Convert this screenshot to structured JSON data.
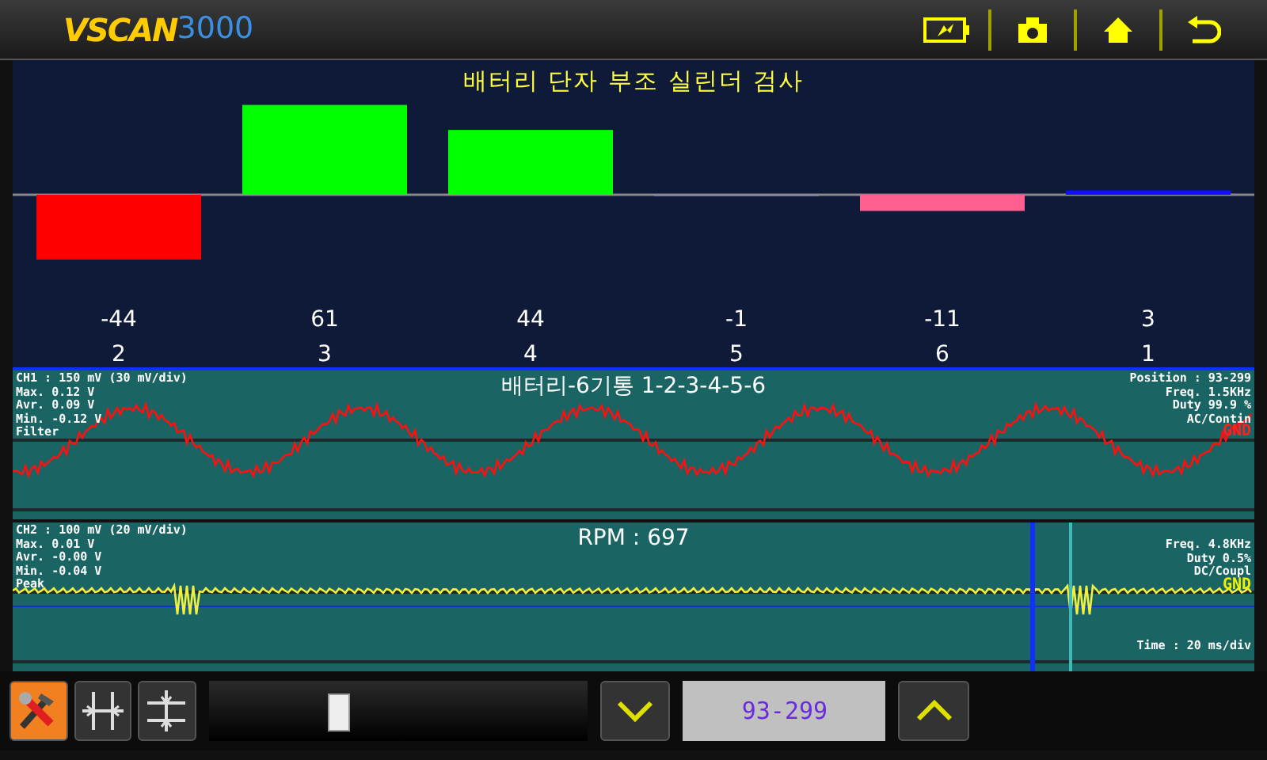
{
  "header": {
    "logo_text": "VSCAN",
    "logo_number": "3000"
  },
  "balance_panel": {
    "title": "배터리 단자 부조 실린더 검사",
    "chart_data": {
      "type": "bar",
      "categories": [
        "2",
        "3",
        "4",
        "5",
        "6",
        "1"
      ],
      "values": [
        -44,
        61,
        44,
        -1,
        -11,
        3
      ],
      "data_labels": true
    }
  },
  "scopes": [
    {
      "title": "배터리-6기통 1-2-3-4-5-6",
      "channel_info": [
        "CH1 : 150 mV (30 mV/div)",
        "Max.  0.12 V",
        "Avr.  0.09 V",
        "Min. -0.12 V",
        "Filter"
      ],
      "right_info": [
        "Position : 93-299",
        "Freq.   1.5KHz",
        "Duty 99.9 %",
        "AC/Contin"
      ],
      "ground_label": "GND",
      "kind": "sine"
    },
    {
      "title": "RPM : 697",
      "channel_info": [
        "CH2 : 100 mV (20 mV/div)",
        "Max.  0.01 V",
        "Avr. -0.00 V",
        "Min. -0.04 V",
        "Peak"
      ],
      "right_info": [
        "Freq.   4.8KHz",
        "Duty 0.5%",
        "DC/Coupl"
      ],
      "ground_label": "GND",
      "time_label": "Time : 20 ms/div",
      "kind": "pulse"
    }
  ],
  "bottom": {
    "slider": {
      "level": 0.32
    },
    "position_field": {
      "value": "93-299"
    }
  }
}
